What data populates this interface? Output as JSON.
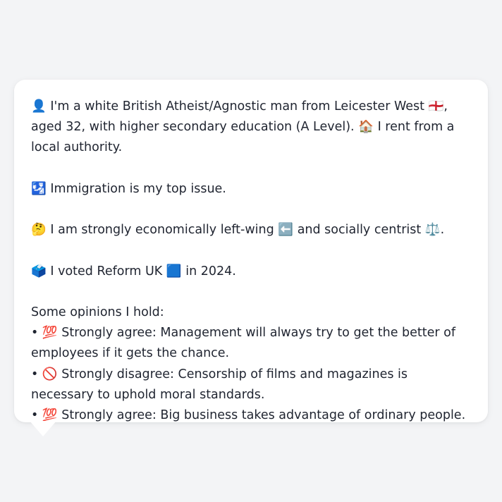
{
  "profile": {
    "line1_emoji": "👤",
    "line1_text": "I'm a white British Atheist/Agnostic man from Leicester West",
    "flag_emoji": "🏴󠁧󠁢󠁥󠁮󠁧󠁿",
    "line1_tail": ", aged 32, with higher secondary education (A Level).",
    "house_emoji": "🏠",
    "housing_text": "I rent from a local authority.",
    "issue_emoji": "🛂",
    "issue_text": "Immigration is my top issue.",
    "politics_emoji": "🤔",
    "politics_text_a": "I am strongly economically left-wing",
    "left_emoji": "⬅️",
    "politics_text_b": "and socially centrist",
    "scales_emoji": "⚖️",
    "politics_end": ".",
    "vote_emoji": "🗳️",
    "vote_text_a": "I voted Reform UK",
    "party_emoji": "🟦",
    "vote_text_b": "in 2024.",
    "opinions_heading": "Some opinions I hold:",
    "opinions": [
      {
        "bullet": "•",
        "emoji": "💯",
        "text": "Strongly agree: Management will always try to get the better of employees if it gets the chance."
      },
      {
        "bullet": "•",
        "emoji": "🚫",
        "text": "Strongly disagree: Censorship of films and magazines is necessary to uphold moral standards."
      },
      {
        "bullet": "•",
        "emoji": "💯",
        "text": "Strongly agree: Big business takes advantage of ordinary people."
      }
    ]
  }
}
